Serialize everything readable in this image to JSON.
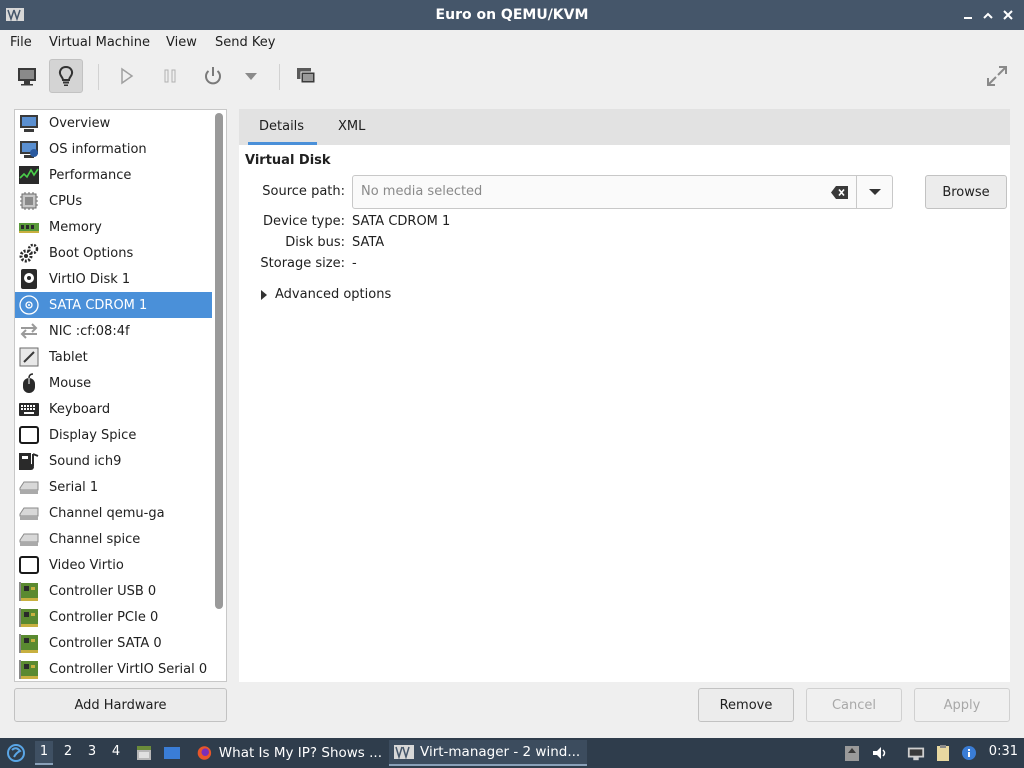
{
  "window": {
    "title": "Euro on QEMU/KVM"
  },
  "menu": [
    "File",
    "Virtual Machine",
    "View",
    "Send Key"
  ],
  "sidebar": {
    "items": [
      {
        "label": "Overview",
        "icon": "monitor-icon"
      },
      {
        "label": "OS information",
        "icon": "monitor-info-icon"
      },
      {
        "label": "Performance",
        "icon": "performance-graph-icon"
      },
      {
        "label": "CPUs",
        "icon": "cpu-chip-icon"
      },
      {
        "label": "Memory",
        "icon": "memory-module-icon"
      },
      {
        "label": "Boot Options",
        "icon": "gears-icon"
      },
      {
        "label": "VirtIO Disk 1",
        "icon": "hard-disk-icon"
      },
      {
        "label": "SATA CDROM 1",
        "icon": "cdrom-icon"
      },
      {
        "label": "NIC :cf:08:4f",
        "icon": "network-arrows-icon"
      },
      {
        "label": "Tablet",
        "icon": "tablet-icon"
      },
      {
        "label": "Mouse",
        "icon": "mouse-icon"
      },
      {
        "label": "Keyboard",
        "icon": "keyboard-icon"
      },
      {
        "label": "Display Spice",
        "icon": "display-icon"
      },
      {
        "label": "Sound ich9",
        "icon": "sound-card-icon"
      },
      {
        "label": "Serial 1",
        "icon": "serial-port-icon"
      },
      {
        "label": "Channel qemu-ga",
        "icon": "channel-icon"
      },
      {
        "label": "Channel spice",
        "icon": "channel-icon"
      },
      {
        "label": "Video Virtio",
        "icon": "video-icon"
      },
      {
        "label": "Controller USB 0",
        "icon": "controller-card-icon"
      },
      {
        "label": "Controller PCIe 0",
        "icon": "controller-card-icon"
      },
      {
        "label": "Controller SATA 0",
        "icon": "controller-card-icon"
      },
      {
        "label": "Controller VirtIO Serial 0",
        "icon": "controller-card-icon"
      }
    ],
    "selected_index": 7,
    "add_hardware_label": "Add Hardware"
  },
  "tabs": [
    "Details",
    "XML"
  ],
  "details": {
    "section_title": "Virtual Disk",
    "source_path_label": "Source path:",
    "source_path_placeholder": "No media selected",
    "browse_label": "Browse",
    "device_type_label": "Device type:",
    "device_type_value": "SATA CDROM 1",
    "disk_bus_label": "Disk bus:",
    "disk_bus_value": "SATA",
    "storage_size_label": "Storage size:",
    "storage_size_value": "-",
    "advanced_label": "Advanced options"
  },
  "actions": {
    "remove": "Remove",
    "cancel": "Cancel",
    "apply": "Apply"
  },
  "taskbar": {
    "workspaces": [
      "1",
      "2",
      "3",
      "4"
    ],
    "active_workspace": "1",
    "tasks": [
      {
        "label": "What Is My IP? Shows ...",
        "icon": "firefox-icon"
      },
      {
        "label": "Virt-manager - 2 wind...",
        "icon": "virt-manager-icon"
      }
    ],
    "clock": "0:31"
  },
  "colors": {
    "accent": "#4a90d9",
    "titlebar": "#45566a",
    "taskbar": "#2f3d4c"
  }
}
